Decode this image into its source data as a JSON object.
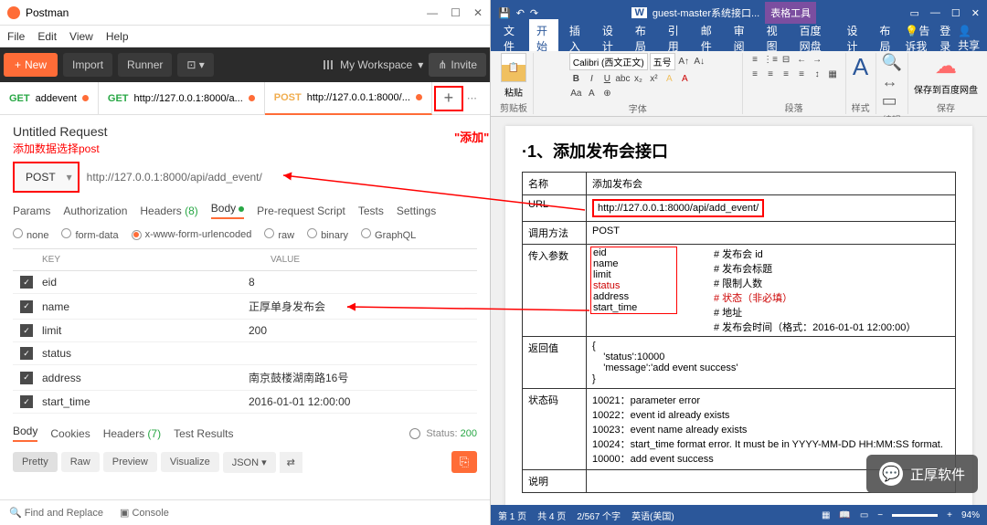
{
  "postman": {
    "title": "Postman",
    "menu": [
      "File",
      "Edit",
      "View",
      "Help"
    ],
    "toolbar": {
      "new": "New",
      "import": "Import",
      "runner": "Runner",
      "workspace": "My Workspace",
      "invite": "Invite"
    },
    "tabs": [
      {
        "method": "GET",
        "label": "addevent",
        "dirty": true
      },
      {
        "method": "GET",
        "label": "http://127.0.0.1:8000/a...",
        "dirty": true
      },
      {
        "method": "POST",
        "label": "http://127.0.0.1:8000/...",
        "dirty": true,
        "active": true
      }
    ],
    "request": {
      "title": "Untitled Request",
      "anno": "添加数据选择post",
      "method": "POST",
      "url": "http://127.0.0.1:8000/api/add_event/",
      "tabs": [
        "Params",
        "Authorization",
        "Headers (8)",
        "Body",
        "Pre-request Script",
        "Tests",
        "Settings"
      ],
      "active_tab": "Body",
      "body_modes": [
        "none",
        "form-data",
        "x-www-form-urlencoded",
        "raw",
        "binary",
        "GraphQL"
      ],
      "selected_mode": "x-www-form-urlencoded",
      "kv_head": {
        "k": "KEY",
        "v": "VALUE"
      },
      "kv": [
        {
          "k": "eid",
          "v": "8"
        },
        {
          "k": "name",
          "v": "正厚单身发布会"
        },
        {
          "k": "limit",
          "v": "200"
        },
        {
          "k": "status",
          "v": ""
        },
        {
          "k": "address",
          "v": "南京鼓楼湖南路16号"
        },
        {
          "k": "start_time",
          "v": "2016-01-01 12:00:00"
        }
      ]
    },
    "response": {
      "tabs": [
        "Body",
        "Cookies",
        "Headers (7)",
        "Test Results"
      ],
      "active": "Body",
      "status": "Status: 200",
      "view": [
        "Pretty",
        "Raw",
        "Preview",
        "Visualize"
      ],
      "format": "JSON"
    },
    "footer": {
      "find": "Find and Replace",
      "console": "Console"
    }
  },
  "anno_add": "\"添加\"",
  "word": {
    "doc_title": "guest-master系统接口...",
    "tool_tab": "表格工具",
    "tabs": [
      "文件",
      "开始",
      "插入",
      "设计",
      "布局",
      "引用",
      "邮件",
      "审阅",
      "视图",
      "百度网盘",
      "设计",
      "布局"
    ],
    "right": {
      "tell": "告诉我",
      "login": "登录",
      "share": "共享"
    },
    "ribbon": {
      "paste": "粘贴",
      "clip": "剪贴板",
      "font_name": "Calibri (西文正文)",
      "font_size": "五号",
      "font": "字体",
      "para": "段落",
      "style": "样式",
      "edit": "编辑",
      "save": "保存到百度网盘",
      "save_g": "保存"
    },
    "doc": {
      "h1": "·1、添加发布会接口",
      "rows": {
        "name_l": "名称",
        "name_v": "添加发布会",
        "url_l": "URL",
        "url_v": "http://127.0.0.1:8000/api/add_event/",
        "method_l": "调用方法",
        "method_v": "POST",
        "params_l": "传入参数",
        "params": [
          {
            "n": "eid",
            "d": "# 发布会 id"
          },
          {
            "n": "name",
            "d": "# 发布会标题"
          },
          {
            "n": "limit",
            "d": "# 限制人数"
          },
          {
            "n": "status",
            "d": "# 状态（非必填）",
            "red": true
          },
          {
            "n": "address",
            "d": "# 地址"
          },
          {
            "n": "start_time",
            "d": "# 发布会时间（格式：2016-01-01 12:00:00）"
          }
        ],
        "return_l": "返回值",
        "return_v": [
          "{",
          "    'status':10000",
          "    'message':'add event success'",
          "}"
        ],
        "code_l": "状态码",
        "codes": [
          "10021：parameter error",
          "10022：event id already exists",
          "10023：event name already exists",
          "10024：start_time format error. It must be in YYYY-MM-DD HH:MM:SS format.",
          "10000：add event success"
        ],
        "desc_l": "说明"
      }
    },
    "status": {
      "page": "第 1 页",
      "pages": "共 4 页",
      "words": "2/567 个字",
      "lang": "英语(美国)",
      "zoom": "94%"
    }
  },
  "badge": "正厚软件"
}
